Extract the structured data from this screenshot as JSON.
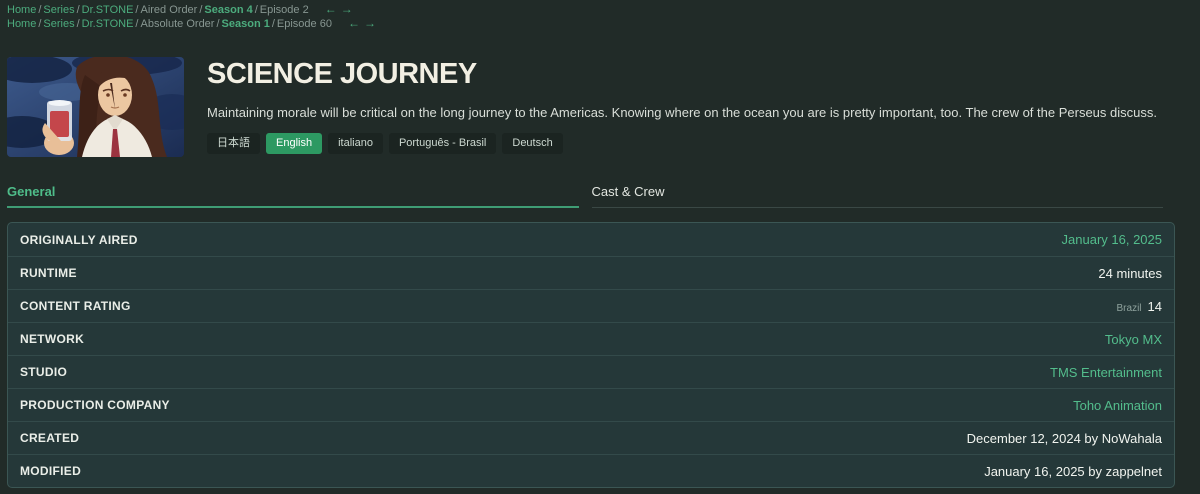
{
  "colors": {
    "page_background": "#212b28",
    "panel_background": "#253839",
    "accent_green": "#4fbd8a",
    "link_green": "#53bd8c",
    "active_button_green": "#2d9962"
  },
  "breadcrumbs": {
    "separator": "/",
    "prev_arrow": "←",
    "next_arrow": "→",
    "lines": [
      {
        "items": [
          "Home",
          "Series",
          "Dr.STONE",
          "Aired Order",
          "Season 4",
          "Episode 2"
        ]
      },
      {
        "items": [
          "Home",
          "Series",
          "Dr.STONE",
          "Absolute Order",
          "Season 1",
          "Episode 60"
        ]
      }
    ]
  },
  "header": {
    "title": "SCIENCE JOURNEY",
    "overview": "Maintaining morale will be critical on the long journey to the Americas. Knowing where on the ocean you are is pretty important, too. The crew of the Perseus discuss."
  },
  "languages": {
    "items": [
      {
        "label": "日本語",
        "active": false
      },
      {
        "label": "English",
        "active": true
      },
      {
        "label": "italiano",
        "active": false
      },
      {
        "label": "Português - Brasil",
        "active": false
      },
      {
        "label": "Deutsch",
        "active": false
      }
    ]
  },
  "tabs": {
    "general": "General",
    "cast_crew": "Cast & Crew"
  },
  "details": {
    "rows": [
      {
        "label": "ORIGINALLY AIRED",
        "value": "January 16, 2025",
        "is_link": true
      },
      {
        "label": "RUNTIME",
        "value": "24 minutes",
        "is_link": false
      },
      {
        "label": "CONTENT RATING",
        "country": "Brazil",
        "value": "14",
        "is_link": false
      },
      {
        "label": "NETWORK",
        "value": "Tokyo MX",
        "is_link": true
      },
      {
        "label": "STUDIO",
        "value": "TMS Entertainment",
        "is_link": true
      },
      {
        "label": "PRODUCTION COMPANY",
        "value": "Toho Animation",
        "is_link": true
      },
      {
        "label": "CREATED",
        "value": "December 12, 2024 by NoWahala",
        "is_link": false
      },
      {
        "label": "MODIFIED",
        "value": "January 16, 2025 by zappelnet",
        "is_link": false
      }
    ]
  }
}
